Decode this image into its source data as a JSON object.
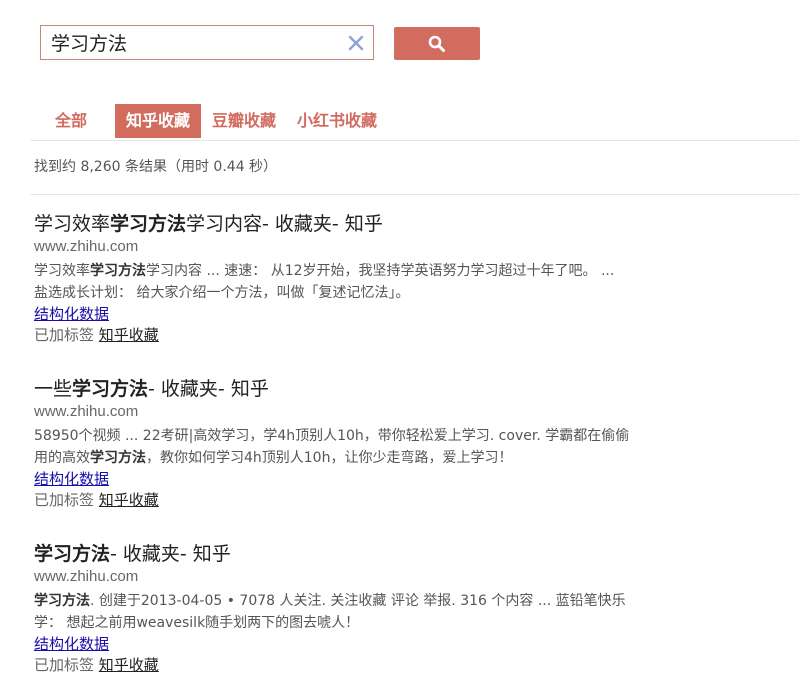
{
  "search": {
    "value": "学习方法",
    "button_icon": "search-icon",
    "clear_icon": "close-icon"
  },
  "tabs": [
    {
      "label": "全部",
      "active": false
    },
    {
      "label": "知乎收藏",
      "active": true
    },
    {
      "label": "豆瓣收藏",
      "active": false
    },
    {
      "label": "小红书收藏",
      "active": false
    }
  ],
  "stats": "找到约 8,260 条结果（用时 0.44 秒）",
  "results": [
    {
      "title": [
        "学习效率",
        "学习方法",
        "学习内容- 收藏夹- 知乎"
      ],
      "url": "www.zhihu.com",
      "snippet1": [
        "学习效率",
        "学习方法",
        "学习内容 ... 速速： 从12岁开始，我坚持学英语努力学习超过十年了吧。 ..."
      ],
      "snippet2": "盐选成长计划： 给大家介绍一个方法，叫做「复述记忆法」。",
      "structured": "结构化数据",
      "tag_prefix": "已加标签",
      "tag_link": "知乎收藏"
    },
    {
      "title": [
        "一些",
        "学习方法",
        "- 收藏夹- 知乎"
      ],
      "url": "www.zhihu.com",
      "snippet1": [
        "58950个视频 ... 22考研|高效学习，学4h顶别人10h，带你轻松爱上学习. cover. 学霸都在偷偷",
        "",
        ""
      ],
      "snippet2": [
        "用的高效",
        "学习方法",
        "，教你如何学习4h顶别人10h，让你少走弯路，爱上学习！"
      ],
      "structured": "结构化数据",
      "tag_prefix": "已加标签",
      "tag_link": "知乎收藏"
    },
    {
      "title": [
        "",
        "学习方法",
        "- 收藏夹- 知乎"
      ],
      "url": "www.zhihu.com",
      "snippet1": [
        "",
        "学习方法",
        ". 创建于2013-04-05 • 7078 人关注. 关注收藏 评论 举报. 316 个内容 ... 蓝铅笔快乐"
      ],
      "snippet2": "学： 想起之前用weavesilk随手划两下的图去唬人！",
      "structured": "结构化数据",
      "tag_prefix": "已加标签",
      "tag_link": "知乎收藏"
    }
  ],
  "colors": {
    "accent": "#d26c5f",
    "link": "#1a0dab"
  }
}
